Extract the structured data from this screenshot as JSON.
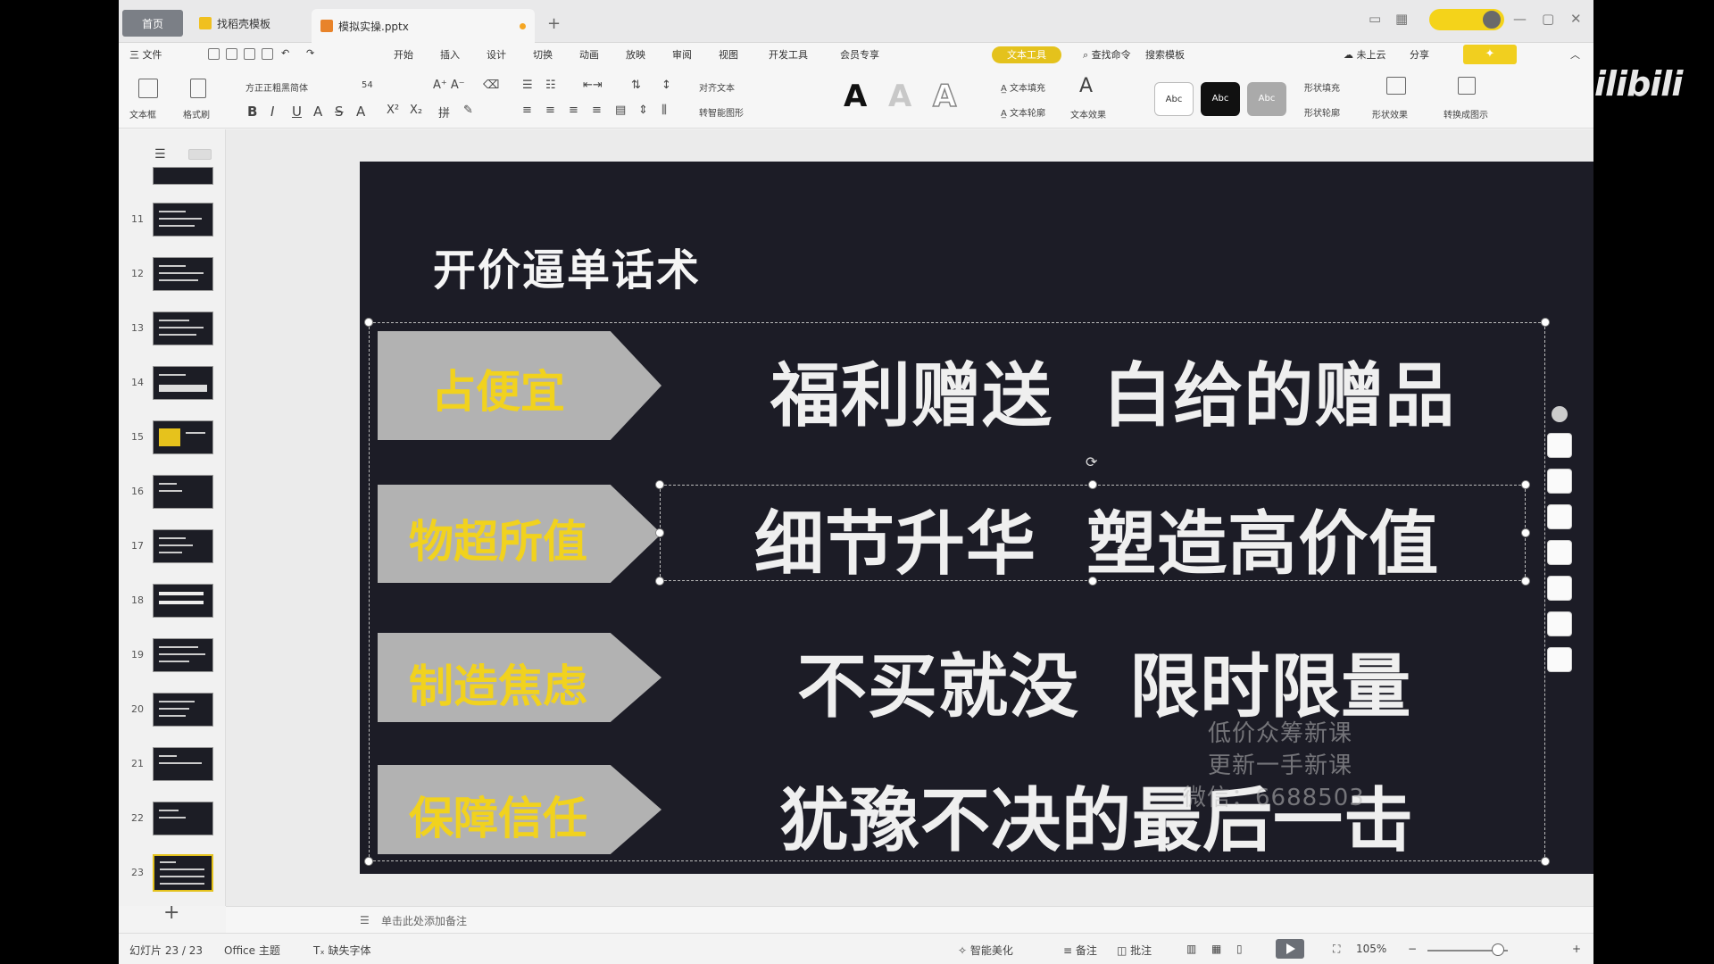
{
  "app": {
    "tabs": [
      {
        "label": "首页"
      },
      {
        "label": "找稻壳模板"
      },
      {
        "label": "模拟实操.pptx"
      }
    ],
    "menu": [
      "三 文件",
      "开始",
      "插入",
      "设计",
      "切换",
      "动画",
      "放映",
      "审阅",
      "视图",
      "开发工具",
      "会员专享"
    ],
    "menu_right": [
      "查找命令",
      "搜索模板",
      "未上云",
      "分享"
    ],
    "special_pill": "文本工具",
    "font_name": "方正正粗黑简体",
    "font_size": "54",
    "ribbon_left": [
      "文本框",
      "格式刷"
    ],
    "ribbon_labels": [
      "对齐文本",
      "转智能图形",
      "文本填充",
      "文本轮廓",
      "文本效果",
      "形状填充",
      "形状轮廓",
      "形状效果",
      "转换成图示"
    ],
    "style_boxes": [
      "Abc",
      "Abc",
      "Abc"
    ],
    "accent": "#f1d21e",
    "slide_bg": "#1c1c26"
  },
  "thumbnails": [
    {
      "num": ""
    },
    {
      "num": "11"
    },
    {
      "num": "12"
    },
    {
      "num": "13"
    },
    {
      "num": "14"
    },
    {
      "num": "15"
    },
    {
      "num": "16"
    },
    {
      "num": "17"
    },
    {
      "num": "18"
    },
    {
      "num": "19"
    },
    {
      "num": "20"
    },
    {
      "num": "21"
    },
    {
      "num": "22"
    },
    {
      "num": "23"
    }
  ],
  "slide": {
    "title": "开价逼单话术",
    "rows": [
      {
        "tag": "占便宜",
        "text": "福利赠送  白给的赠品"
      },
      {
        "tag": "物超所值",
        "text": "细节升华  塑造高价值"
      },
      {
        "tag": "制造焦虑",
        "text": "不买就没  限时限量"
      },
      {
        "tag": "保障信任",
        "text": "犹豫不决的最后一击"
      }
    ],
    "watermark": [
      "低价众筹新课",
      "更新一手新课",
      "微信：6688503"
    ]
  },
  "notes_placeholder": "单击此处添加备注",
  "status": {
    "slide_count": "幻灯片 23 / 23",
    "theme": "Office 主题",
    "missing_font": "缺失字体",
    "smart_beautify": "智能美化",
    "notes": "备注",
    "comments": "批注",
    "zoom": "105%"
  },
  "overlay": {
    "brand": "ilibili"
  }
}
